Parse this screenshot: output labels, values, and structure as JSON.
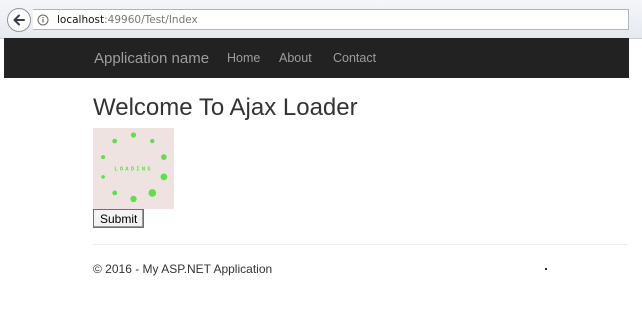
{
  "browser": {
    "url_host": "localhost",
    "url_rest": ":49960/Test/Index"
  },
  "navbar": {
    "brand": "Application name",
    "links": [
      "Home",
      "About",
      "Contact"
    ],
    "background": "#222222",
    "link_color": "#9d9d9d"
  },
  "main": {
    "title": "Welcome To Ajax Loader",
    "loader": {
      "text": "LOADING",
      "dot_color": "#5ee04a",
      "background": "#efe3e1"
    },
    "submit_label": "Submit"
  },
  "footer": {
    "text": "© 2016 - My ASP.NET Application"
  }
}
